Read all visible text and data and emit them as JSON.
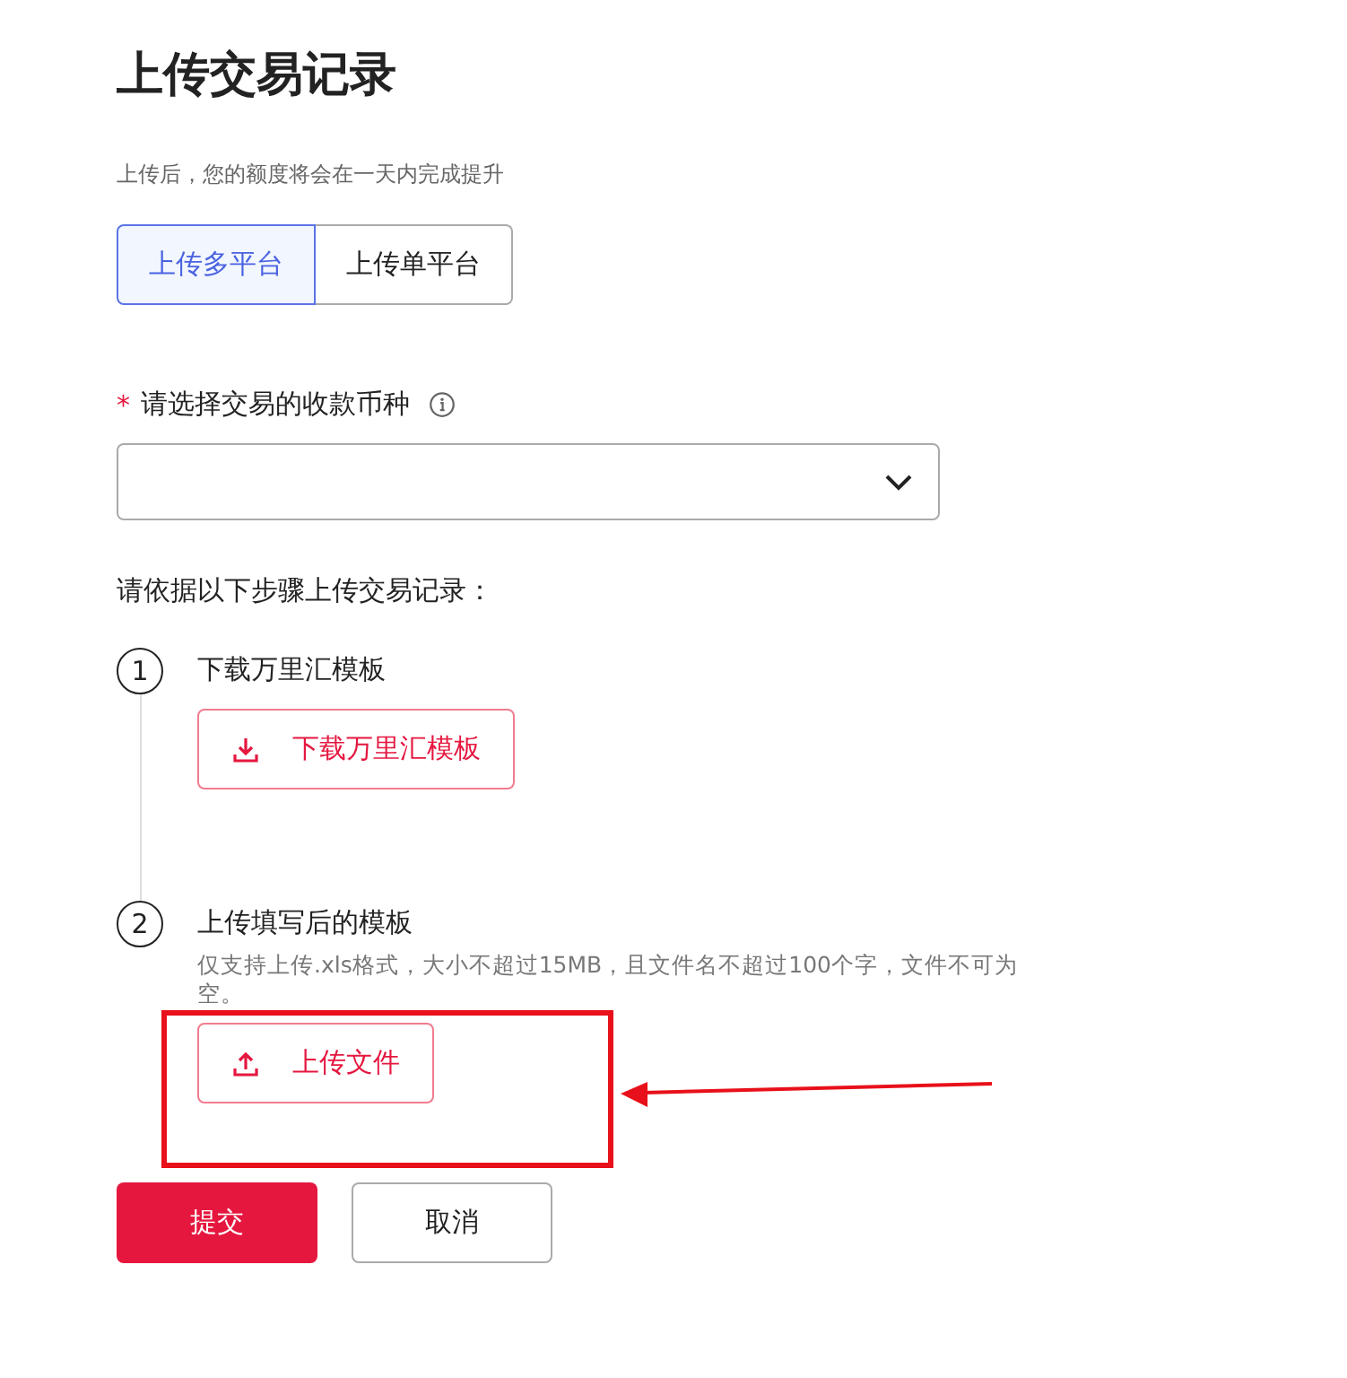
{
  "title": "上传交易记录",
  "subtitle": "上传后，您的额度将会在一天内完成提升",
  "tabs": [
    {
      "label": "上传多平台",
      "selected": true
    },
    {
      "label": "上传单平台",
      "selected": false
    }
  ],
  "currency_field": {
    "label": "请选择交易的收款币种",
    "required_mark": "*"
  },
  "instructions": "请依据以下步骤上传交易记录：",
  "steps": [
    {
      "number": "1",
      "title": "下载万里汇模板",
      "button": {
        "label": "下载万里汇模板",
        "kind": "download"
      }
    },
    {
      "number": "2",
      "title": "上传填写后的模板",
      "hint": "仅支持上传.xls格式，大小不超过15MB，且文件名不超过100个字，文件不可为空。",
      "button": {
        "label": "上传文件",
        "kind": "upload"
      }
    }
  ],
  "actions": [
    {
      "label": "提交",
      "kind": "primary"
    },
    {
      "label": "取消",
      "kind": "secondary"
    }
  ]
}
